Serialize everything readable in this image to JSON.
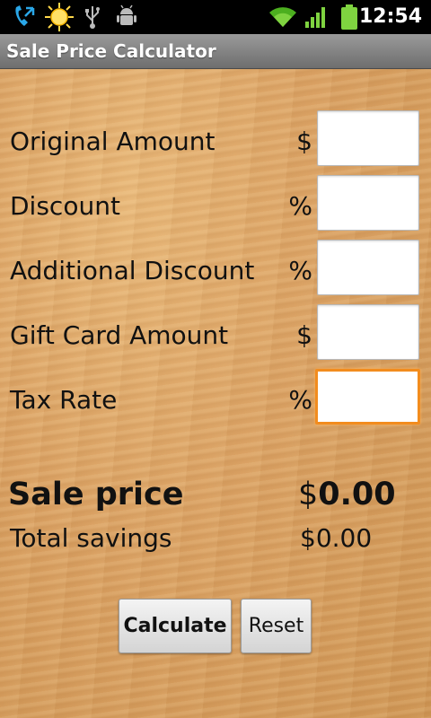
{
  "status_bar": {
    "time": "12:54",
    "icons": [
      "phone-call-icon",
      "sun-weather-icon",
      "usb-icon",
      "android-debug-icon",
      "wifi-icon",
      "signal-icon",
      "battery-icon"
    ]
  },
  "app": {
    "title": "Sale Price Calculator"
  },
  "form": {
    "original_amount": {
      "label": "Original Amount",
      "unit": "$",
      "value": ""
    },
    "discount": {
      "label": "Discount",
      "unit": "%",
      "value": ""
    },
    "additional_discount": {
      "label": "Additional Discount",
      "unit": "%",
      "value": ""
    },
    "gift_card_amount": {
      "label": "Gift Card Amount",
      "unit": "$",
      "value": ""
    },
    "tax_rate": {
      "label": "Tax Rate",
      "unit": "%",
      "value": ""
    }
  },
  "results": {
    "sale_price_label": "Sale price",
    "sale_price_currency": "$",
    "sale_price_value": "0.00",
    "total_savings_label": "Total savings",
    "total_savings_value": "$0.00"
  },
  "buttons": {
    "calculate": "Calculate",
    "reset": "Reset"
  },
  "colors": {
    "focus_accent": "#f28c1e",
    "wood": "#dba264"
  }
}
